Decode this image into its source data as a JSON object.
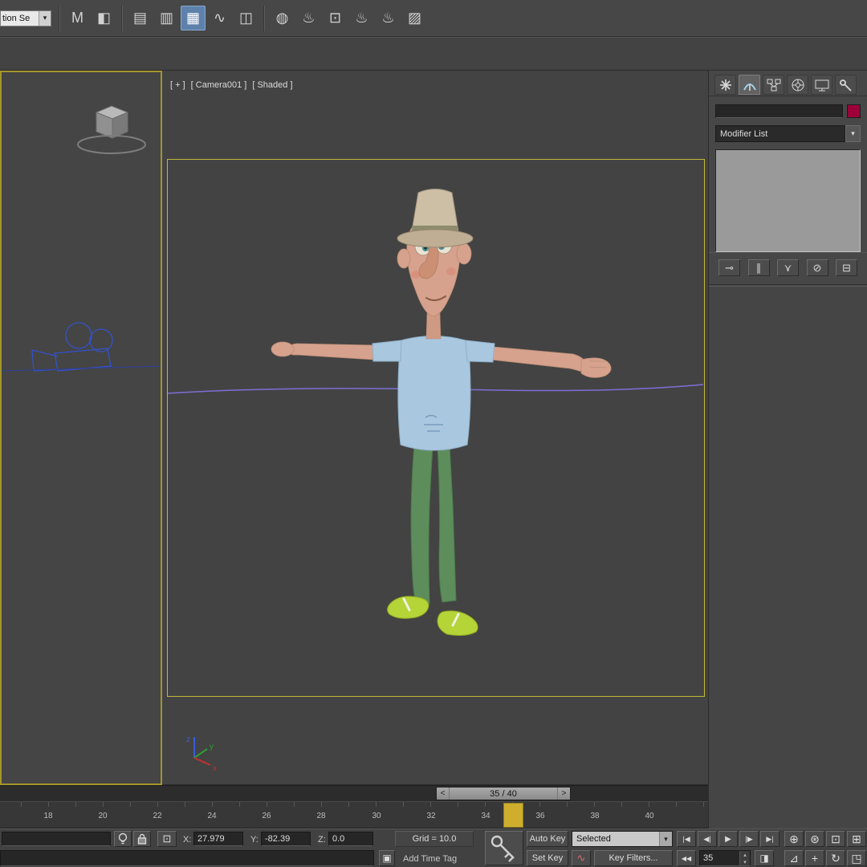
{
  "colors": {
    "accent_yellow": "#c3b83a",
    "marker_yellow": "#cfae2e",
    "swatch_red": "#9d0039",
    "spline_purple": "#7d6fd6",
    "camera_blue": "#3452c8",
    "panel_gray": "#474747",
    "active_tool_blue": "#5e81ab"
  },
  "glyphs": {
    "arrow_down": "▾",
    "spinner_up": "▴",
    "spinner_down": "▾",
    "key_mode": "◀◀",
    "time_config": "◨",
    "set_key_wave": "∿",
    "status_panel": "▣",
    "abs_offset": "⊡"
  },
  "toolbar": {
    "selection_set_value": "tion Se",
    "icons": [
      {
        "name": "mirror-button",
        "glyph": "M"
      },
      {
        "name": "align-button",
        "glyph": "◧"
      },
      {
        "name": "scene-explorer-button",
        "glyph": "▤"
      },
      {
        "name": "layer-explorer-button",
        "glyph": "▥"
      },
      {
        "name": "ribbon-toggle-button",
        "glyph": "▦",
        "active": true
      },
      {
        "name": "curve-editor-button",
        "glyph": "∿"
      },
      {
        "name": "schematic-view-button",
        "glyph": "◫"
      },
      {
        "name": "material-editor-button",
        "glyph": "◍"
      },
      {
        "name": "render-setup-button",
        "glyph": "♨"
      },
      {
        "name": "rendered-frame-window-button",
        "glyph": "⊡"
      },
      {
        "name": "render-production-button",
        "glyph": "♨"
      },
      {
        "name": "render-iterative-button",
        "glyph": "♨"
      },
      {
        "name": "open-gallery-button",
        "glyph": "▨"
      }
    ]
  },
  "viewport": {
    "label_plus": "[ + ]",
    "label_camera": "[ Camera001 ]",
    "label_shading": "[ Shaded ]",
    "axis": {
      "x": "x",
      "y": "y",
      "z": "z"
    }
  },
  "right_panel": {
    "tabs": [
      "create",
      "modify",
      "hierarchy",
      "motion",
      "display",
      "utilities"
    ],
    "selected_tab": "modify",
    "modifier_list_label": "Modifier List",
    "stack_buttons": [
      {
        "name": "pin-stack-button",
        "glyph": "⊸"
      },
      {
        "name": "show-end-result-button",
        "glyph": "∥"
      },
      {
        "name": "make-unique-button",
        "glyph": "⋎"
      },
      {
        "name": "remove-modifier-button",
        "glyph": "⊘"
      },
      {
        "name": "configure-modifier-sets-button",
        "glyph": "⊟"
      }
    ]
  },
  "time_slider": {
    "prev": "<",
    "value": "35 / 40",
    "next": ">"
  },
  "track_bar": {
    "ticks": [
      "18",
      "20",
      "22",
      "24",
      "26",
      "28",
      "30",
      "32",
      "34",
      "36",
      "38",
      "40"
    ],
    "current_frame": "35"
  },
  "status_bar": {
    "x_label": "X:",
    "x_value": "27.979",
    "y_label": "Y:",
    "y_value": "-82.39",
    "z_label": "Z:",
    "z_value": "0.0",
    "grid_label": "Grid = 10.0",
    "auto_key": "Auto Key",
    "set_key": "Set Key",
    "selection_filter_value": "Selected",
    "key_filters": "Key Filters...",
    "add_time_tag": "Add Time Tag",
    "frame_value": "35",
    "playback": [
      {
        "name": "goto-start-button",
        "glyph": "|◀"
      },
      {
        "name": "previous-frame-button",
        "glyph": "◀|"
      },
      {
        "name": "play-button",
        "glyph": "▶"
      },
      {
        "name": "next-frame-button",
        "glyph": "|▶"
      },
      {
        "name": "goto-end-button",
        "glyph": "▶|"
      }
    ],
    "nav_buttons": [
      {
        "name": "zoom-button",
        "glyph": "⊕"
      },
      {
        "name": "zoom-all-button",
        "glyph": "⊛"
      },
      {
        "name": "zoom-extents-button",
        "glyph": "⊡"
      },
      {
        "name": "zoom-extents-all-button",
        "glyph": "⊞"
      },
      {
        "name": "field-of-view-button",
        "glyph": "⊿"
      },
      {
        "name": "pan-button",
        "glyph": "+"
      },
      {
        "name": "orbit-button",
        "glyph": "↻"
      },
      {
        "name": "maximize-viewport-button",
        "glyph": "◳"
      }
    ]
  }
}
